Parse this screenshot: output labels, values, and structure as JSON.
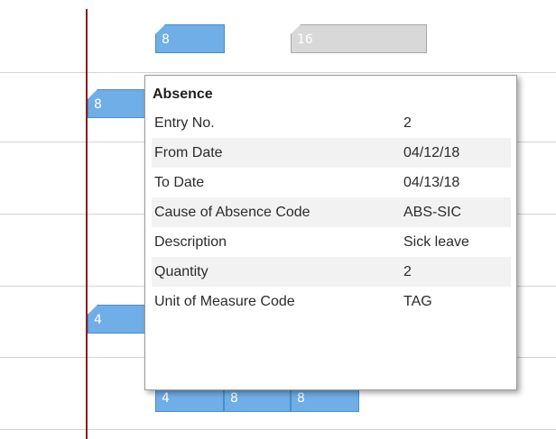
{
  "bars": {
    "top_blue": "8",
    "top_gray": "16",
    "row2_left": "8",
    "row4_left": "4",
    "bottom_a": "4",
    "bottom_b": "8",
    "bottom_c": "8"
  },
  "tooltip": {
    "title": "Absence",
    "rows": [
      {
        "label": "Entry No.",
        "value": "2"
      },
      {
        "label": "From Date",
        "value": "04/12/18"
      },
      {
        "label": "To Date",
        "value": "04/13/18"
      },
      {
        "label": "Cause of Absence Code",
        "value": "ABS-SIC"
      },
      {
        "label": "Description",
        "value": "Sick leave"
      },
      {
        "label": "Quantity",
        "value": "2"
      },
      {
        "label": "Unit of Measure Code",
        "value": "TAG"
      }
    ]
  },
  "colors": {
    "bar_blue": "#6faee6",
    "bar_gray": "#d8d8d8",
    "today_line": "#8b1c24"
  }
}
